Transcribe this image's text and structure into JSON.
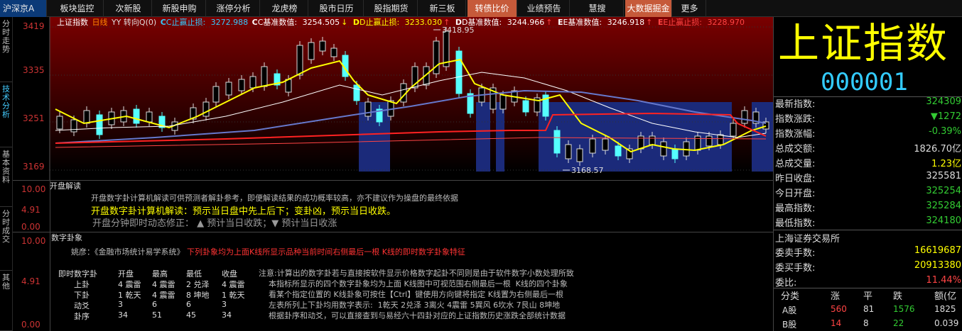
{
  "topbar": {
    "market": "沪深京A",
    "tabs": [
      "板块监控",
      "次新股",
      "新股申购",
      "涨停分析",
      "龙虎榜",
      "股市日历",
      "股指期货",
      "新三板",
      "转债比价",
      "业绩预告",
      "慧搜",
      "大数据掘金",
      "更多"
    ],
    "highlight": [
      8,
      11
    ]
  },
  "left_tabs": [
    "分时走势",
    "技术分析",
    "基本资料",
    "分时成交",
    "其他"
  ],
  "kline": {
    "ylabels": [
      "3419",
      "3335",
      "3251",
      "3169"
    ],
    "high_label": "3418.95",
    "low_label": "3168.57",
    "legend": {
      "name": "上证指数",
      "period": "日线",
      "yy": "YY 转向Q(0)",
      "c_stop": "C止赢止损:",
      "c_stop_v": "3272.988",
      "c_base": "C基准数值:",
      "c_base_v": "3254.505",
      "d_stop": "D止赢止损:",
      "d_stop_v": "3233.030",
      "d_base": "D基准数值:",
      "d_base_v": "3244.966",
      "e_base": "E基准数值:",
      "e_base_v": "3246.918",
      "e_stop": "E止赢止损:",
      "e_stop_v": "3228.970"
    }
  },
  "panel1": {
    "ylabels": [
      "10.00",
      "4.91",
      "0.00"
    ],
    "title": "开盘解读",
    "notice": "开盘数字卦计算机解读可供预测者解卦参考，即便解读结果的成功概率较高，亦不建议作为操盘的最终依据",
    "main": "开盘数字卦计算机解读：预示当日盘中先上后下；变卦凶，预示当日收跌。",
    "minute": "开盘分钟即时动态修正：  ▲  预计当日收跌；▼  预计当日收涨"
  },
  "panel2": {
    "ylabels": [
      "10.00",
      "4.91",
      "0.00"
    ],
    "title": "数字卦象",
    "yaoyan_prefix": "姚彦：《金融市场统计易学系统》",
    "yaoyan_red": "下列卦象均为上面K线所显示品种当前时间右侧最后一根  K线的即时数字卦象特征",
    "table": {
      "headers": [
        "即时数字卦",
        "开盘",
        "最高",
        "最低",
        "收盘"
      ],
      "rows": [
        [
          "上卦",
          "4 震雷",
          "4 震雷",
          "2 兑泽",
          "4 震雷"
        ],
        [
          "下卦",
          "1 乾天",
          "4 震雷",
          "8 坤地",
          "1 乾天"
        ],
        [
          "动爻",
          "3",
          "6",
          "6",
          "3"
        ],
        [
          "卦序",
          "34",
          "51",
          "45",
          "34"
        ]
      ]
    },
    "note": "注意:计算出的数字卦若与直接按软件显示价格数字起卦不同则是由于软件数字小数处理所致\n    本指标所显示的四个数字卦象均为上面 K线图中可视范围右侧最后一根  K线的四个卦象\n    看某个指定位置的 K线卦象可按住【Ctrl】键使用方向键将指定 K线置为右侧最后一根\n    左表所列上下卦均用数字表示:  1乾天 2兑泽 3离火 4震雷 5巽风 6坎水 7艮山 8坤地\n    根据卦序和动爻，可以直接查到与易经六十四卦对应的上证指数历史涨跌全部统计数据"
  },
  "right": {
    "name": "上证指数",
    "code": "000001",
    "rows": [
      {
        "k": "最新指数:",
        "v": "324309",
        "c": "#3c3"
      },
      {
        "k": "指数涨跌:",
        "v": "▼1272",
        "c": "#3c3"
      },
      {
        "k": "指数涨幅:",
        "v": "-0.39%",
        "c": "#3c3"
      },
      {
        "k": "总成交额:",
        "v": "1826.70亿",
        "c": "#ddd"
      },
      {
        "k": "总成交量:",
        "v": "1.23亿",
        "c": "#ff0"
      },
      {
        "k": "昨日收盘:",
        "v": "325581",
        "c": "#ddd"
      },
      {
        "k": "今日开盘:",
        "v": "325254",
        "c": "#3c3"
      },
      {
        "k": "最高指数:",
        "v": "325284",
        "c": "#3c3"
      },
      {
        "k": "最低指数:",
        "v": "324180",
        "c": "#3c3"
      }
    ],
    "exchange": "上海证券交易所",
    "rows2": [
      {
        "k": "委卖手数:",
        "v": "16619687",
        "c": "#ff0"
      },
      {
        "k": "委买手数:",
        "v": "20913380",
        "c": "#ff0"
      },
      {
        "k": "委比:",
        "v": "11.44%",
        "c": "#f44"
      }
    ],
    "table_headers": [
      "分类",
      "涨",
      "平",
      "跌",
      "额(亿"
    ],
    "table_rows": [
      [
        "A股",
        "560",
        "81",
        "1576",
        "1825"
      ],
      [
        "B股",
        "14",
        "8",
        "22",
        "0.039"
      ]
    ]
  }
}
